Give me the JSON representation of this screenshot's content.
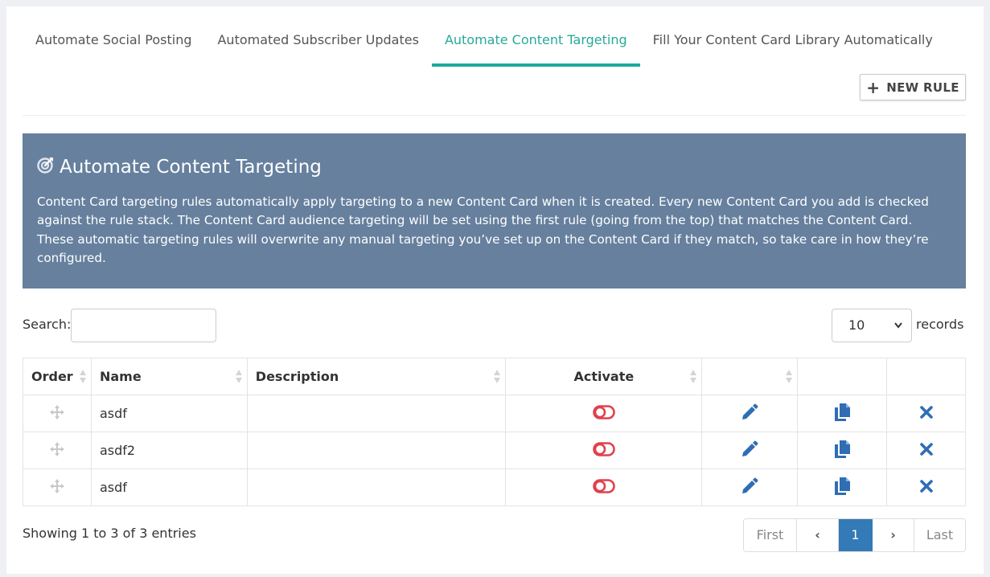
{
  "tabs": [
    {
      "label": "Automate Social Posting",
      "active": false
    },
    {
      "label": "Automated Subscriber Updates",
      "active": false
    },
    {
      "label": "Automate Content Targeting",
      "active": true
    },
    {
      "label": "Fill Your Content Card Library Automatically",
      "active": false
    }
  ],
  "toolbar": {
    "new_rule_label": "NEW RULE"
  },
  "info": {
    "title": "Automate Content Targeting",
    "icon": "target-pin-icon",
    "text": "Content Card targeting rules automatically apply targeting to a new Content Card when it is created. Every new Content Card you add is checked against the rule stack. The Content Card audience targeting will be set using the first rule (going from the top) that matches the Content Card. These automatic targeting rules will overwrite any manual targeting you’ve set up on the Content Card if they match, so take care in how they’re configured."
  },
  "search": {
    "label": "Search:",
    "value": "",
    "placeholder": ""
  },
  "records": {
    "selected": "10",
    "label": "records"
  },
  "table": {
    "headers": [
      "Order",
      "Name",
      "Description",
      "Activate",
      "",
      "",
      ""
    ],
    "rows": [
      {
        "name": "asdf",
        "description": "",
        "active": false
      },
      {
        "name": "asdf2",
        "description": "",
        "active": false
      },
      {
        "name": "asdf",
        "description": "",
        "active": false
      }
    ]
  },
  "footer": {
    "showing": "Showing 1 to 3 of 3 entries"
  },
  "pagination": {
    "first": "First",
    "prev": "‹",
    "current": "1",
    "next": "›",
    "last": "Last"
  },
  "colors": {
    "tab_active": "#1fa89a",
    "info_bg": "#66809e",
    "toggle_off": "#e0414c",
    "action_blue": "#2f6db5",
    "page_current": "#337ab7"
  }
}
